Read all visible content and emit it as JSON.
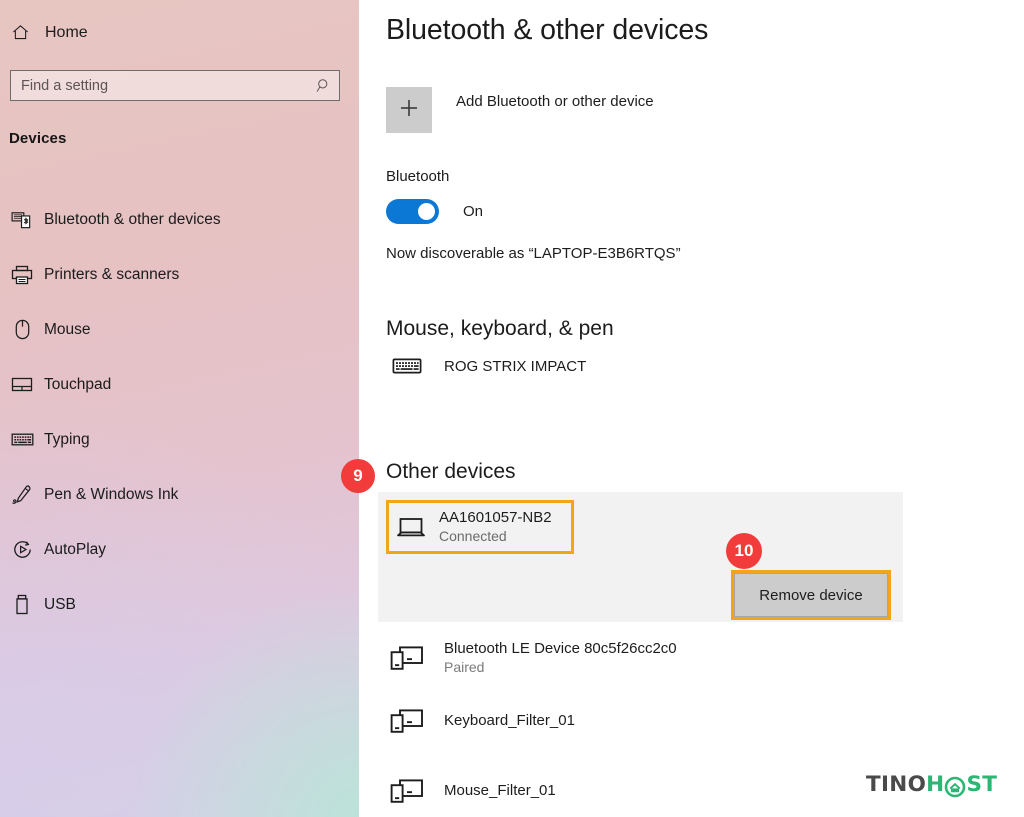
{
  "sidebar": {
    "home": {
      "label": "Home",
      "icon": "home-icon"
    },
    "search": {
      "value": "",
      "placeholder": "Find a setting",
      "icon": "search-icon"
    },
    "section_heading": "Devices",
    "items": [
      {
        "label": "Bluetooth & other devices",
        "icon": "bluetooth-devices-icon"
      },
      {
        "label": "Printers & scanners",
        "icon": "printer-icon"
      },
      {
        "label": "Mouse",
        "icon": "mouse-icon"
      },
      {
        "label": "Touchpad",
        "icon": "touchpad-icon"
      },
      {
        "label": "Typing",
        "icon": "keyboard-icon"
      },
      {
        "label": "Pen & Windows Ink",
        "icon": "pen-icon"
      },
      {
        "label": "AutoPlay",
        "icon": "autoplay-icon"
      },
      {
        "label": "USB",
        "icon": "usb-icon"
      }
    ]
  },
  "main": {
    "title": "Bluetooth & other devices",
    "add_device": {
      "label": "Add Bluetooth or other device",
      "icon": "plus-icon"
    },
    "bluetooth": {
      "label": "Bluetooth",
      "toggle_state": "On",
      "toggle_on": true,
      "discoverable_text": "Now discoverable as “LAPTOP-E3B6RTQS”"
    },
    "mouse_keyboard_pen": {
      "heading": "Mouse, keyboard, & pen",
      "devices": [
        {
          "name": "ROG STRIX IMPACT",
          "status": "",
          "icon": "keyboard-icon"
        }
      ]
    },
    "other_devices": {
      "heading": "Other devices",
      "selected": {
        "name": "AA1601057-NB2",
        "status": "Connected",
        "icon": "laptop-icon",
        "remove_button": "Remove device"
      },
      "devices": [
        {
          "name": "Bluetooth LE Device 80c5f26cc2c0",
          "status": "Paired",
          "icon": "devices-icon"
        },
        {
          "name": "Keyboard_Filter_01",
          "status": "",
          "icon": "devices-icon"
        },
        {
          "name": "Mouse_Filter_01",
          "status": "",
          "icon": "devices-icon"
        }
      ]
    }
  },
  "annotations": {
    "badges": [
      {
        "number": "9",
        "target": "other-devices-selected-row"
      },
      {
        "number": "10",
        "target": "remove-device-button"
      }
    ],
    "highlight_color": "#f2a516",
    "badge_color": "#f23b3b"
  },
  "watermark": {
    "text_dark": "TIN",
    "text_o": "O",
    "text_h": "H",
    "text_st": "ST",
    "full": "TINOHOST",
    "dark_color": "#4a4a4a",
    "green_color": "#2bb673"
  }
}
